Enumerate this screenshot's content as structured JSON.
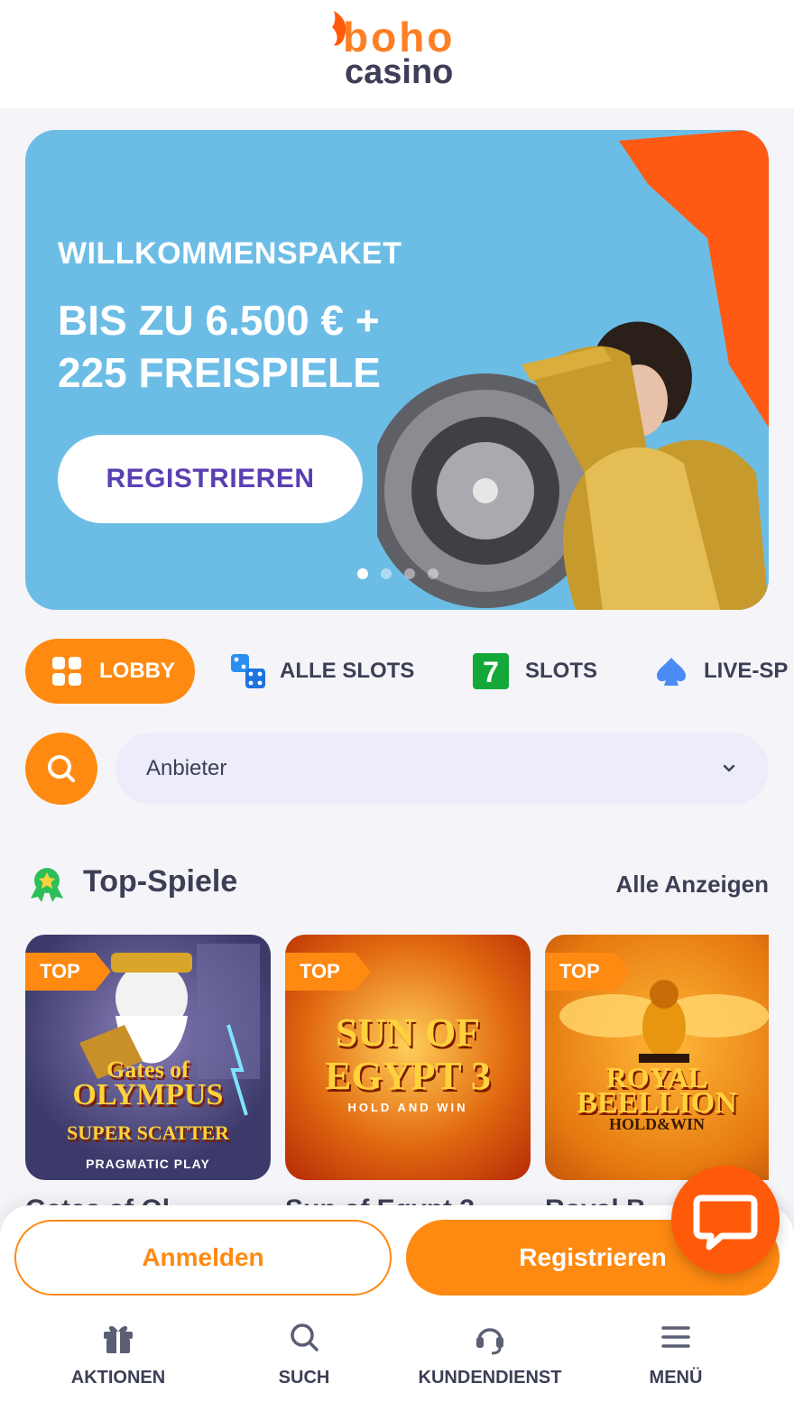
{
  "header": {
    "logo_top": "boho",
    "logo_bottom": "casino"
  },
  "hero": {
    "kicker": "WILLKOMMENSPAKET",
    "headline_1": "BIS ZU 6.500 € +",
    "headline_2": "225 FREISPIELE",
    "cta": "REGISTRIEREN",
    "slides": 4,
    "active_slide": 1
  },
  "categories": [
    {
      "label": "LOBBY",
      "icon": "grid-icon",
      "active": true
    },
    {
      "label": "ALLE SLOTS",
      "icon": "dice-icon",
      "active": false
    },
    {
      "label": "SLOTS",
      "icon": "seven-icon",
      "active": false
    },
    {
      "label": "LIVE-SP",
      "icon": "spade-icon",
      "active": false
    }
  ],
  "search": {
    "icon": "search-icon",
    "provider_placeholder": "Anbieter"
  },
  "section": {
    "title": "Top-Spiele",
    "link": "Alle Anzeigen",
    "icon": "award-icon"
  },
  "games": [
    {
      "badge": "TOP",
      "title_1": "Gates of",
      "title_2": "OLYMPUS",
      "title_3": "SUPER SCATTER",
      "provider": "PRAGMATIC PLAY",
      "name": "Gates of Olympus Super Scatter"
    },
    {
      "badge": "TOP",
      "title_1": "SUN OF",
      "title_2": "EGYPT 3",
      "title_3": "HOLD AND WIN",
      "name": "Sun of Egypt 3"
    },
    {
      "badge": "TOP",
      "title_1": "ROYAL",
      "title_2": "BEELLION",
      "title_3": "HOLD&WIN",
      "name": "Royal Beellion"
    }
  ],
  "names_partial": [
    "Gates of Ol…",
    "Sun of Egypt 3",
    "Royal B…"
  ],
  "auth": {
    "login": "Anmelden",
    "register": "Registrieren"
  },
  "bottom_nav": [
    {
      "label": "AKTIONEN",
      "icon": "gift-icon"
    },
    {
      "label": "SUCH",
      "icon": "search-icon"
    },
    {
      "label": "KUNDENDIENST",
      "icon": "headset-icon"
    },
    {
      "label": "MENÜ",
      "icon": "menu-icon"
    }
  ],
  "colors": {
    "accent": "#ff8a12",
    "hero_bg": "#6cbde6",
    "cta_text": "#5a3fb3",
    "chat": "#ff5a0a"
  }
}
